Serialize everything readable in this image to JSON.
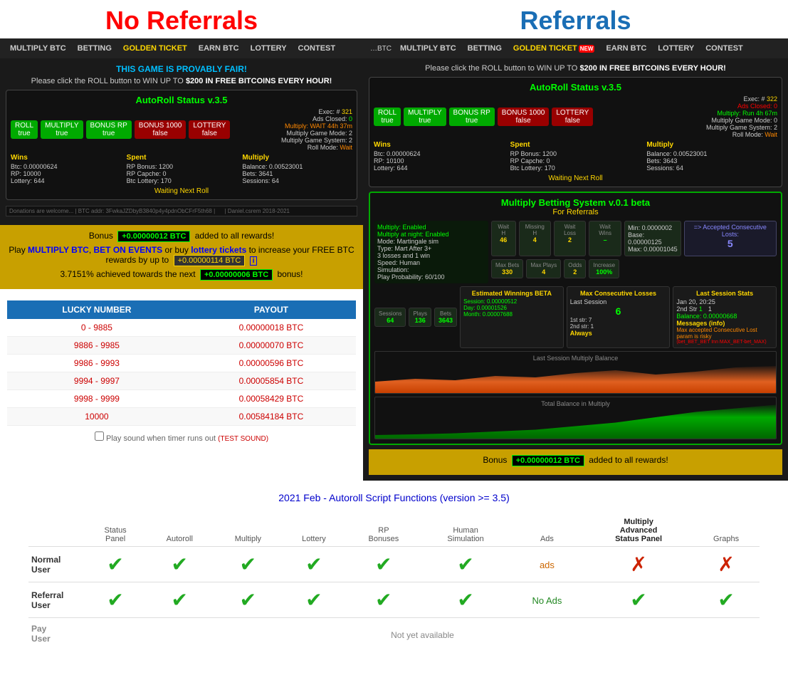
{
  "left": {
    "title": "No Referrals",
    "nav": {
      "items": [
        {
          "label": "MULTIPLY BTC",
          "active": false
        },
        {
          "label": "BETTING",
          "active": false
        },
        {
          "label": "GOLDEN TICKET",
          "active": true,
          "golden": true
        },
        {
          "label": "EARN BTC",
          "active": false
        },
        {
          "label": "LOTTERY",
          "active": false
        },
        {
          "label": "CONTEST",
          "active": false
        }
      ]
    },
    "provably_fair": "THIS GAME IS PROVABLY FAIR!",
    "roll_text": "Please click the ROLL button to WIN UP TO",
    "roll_amount": "$200 IN FREE BITCOINS EVERY HOUR!",
    "autoroll": {
      "title": "AutoRoll Status v.3.5",
      "buttons": [
        "ROLL true",
        "MULTIPLY true",
        "BONUS RP true",
        "BONUS 1000 false",
        "LOTTERY false"
      ],
      "exec_label": "Exec: #",
      "exec_num": "321",
      "ads_closed": "Ads Closed: 0",
      "multiply": "Multiply: WAIT 44h 37m",
      "game_mode": "Multiply Game Mode: 2",
      "game_system": "Multiply Game System: 2",
      "roll_mode": "Roll Mode: Wait",
      "wins_label": "Wins",
      "spent_label": "Spent",
      "multiply_label": "Multiply",
      "btc_stat": "Btc: 0.00000624",
      "rp_bonus": "RP Bonus: 1200",
      "rp_stat": "RP: 10000",
      "btc_lottery": "Btc Lottery: 170",
      "lottery_stat": "Lottery: 644",
      "balance": "Balance: 0.00523001",
      "bets": "Bets: 3641",
      "capache": "RP Capche: 0",
      "sessions": "Sessions: 64",
      "waiting": "Waiting Next Roll"
    },
    "bonus": {
      "bonus_label": "Bonus",
      "bonus_amount": "+0.00000012 BTC",
      "bonus_text": "added to all rewards!",
      "play_text": "Play",
      "multiply_link": "MULTIPLY BTC",
      "bet_link": "BET ON EVENTS",
      "lottery_link": "lottery tickets",
      "free_btc_text": "to increase your FREE BTC rewards by up to",
      "free_amount": "+0.00000114 BTC",
      "progress_text": "3.7151% achieved towards the next",
      "next_bonus": "+0.00000006 BTC",
      "next_bonus_text": "bonus!"
    },
    "payout_table": {
      "col1": "LUCKY NUMBER",
      "col2": "PAYOUT",
      "rows": [
        {
          "range": "0 - 9885",
          "payout": "0.00000018 BTC"
        },
        {
          "range": "9886 - 9985",
          "payout": "0.00000070 BTC"
        },
        {
          "range": "9986 - 9993",
          "payout": "0.00000596 BTC"
        },
        {
          "range": "9994 - 9997",
          "payout": "0.00005854 BTC"
        },
        {
          "range": "9998 - 9999",
          "payout": "0.00058429 BTC"
        },
        {
          "range": "10000",
          "payout": "0.00584184 BTC"
        }
      ]
    },
    "sound_text": "Play sound when timer runs out",
    "sound_test": "(TEST SOUND)"
  },
  "right": {
    "title": "Referrals",
    "nav": {
      "items": [
        {
          "label": "BTC",
          "tiny": true
        },
        {
          "label": "MULTIPLY BTC",
          "active": false
        },
        {
          "label": "BETTING",
          "active": false
        },
        {
          "label": "GOLDEN TICKET",
          "active": true,
          "golden": true,
          "badge": "NEW"
        },
        {
          "label": "EARN BTC",
          "active": false
        },
        {
          "label": "LOTTERY",
          "active": false
        },
        {
          "label": "CONTEST",
          "active": false
        }
      ]
    },
    "roll_text": "Please click the ROLL button to WIN UP TO",
    "roll_amount": "$200 IN FREE BITCOINS EVERY HOUR!",
    "autoroll": {
      "title": "AutoRoll Status v.3.5"
    },
    "multiply_system": {
      "title": "Multiply Betting System v.0.1 beta",
      "subtitle": "For Referrals",
      "enabled": "Multiply: Enabled",
      "at_night": "Multiply at night: Enabled",
      "mode": "Mode: Martingale sim",
      "type": "Type: Mart After 3+",
      "losses_wins": "3 losses and 1 win",
      "speed": "Speed: Human",
      "simulation": "Simulation:",
      "play_prob": "Play Probability: 60/100",
      "wait_h": "Wait H",
      "wait_h_val": "46",
      "missing_h": "Missing H",
      "missing_h_val": "4",
      "wait_loss": "Wait Loss",
      "wait_loss_val": "2",
      "wait_wins": "Wait Wins",
      "wait_wins_val": "",
      "max_bets": "Max Bets",
      "max_bets_val": "330",
      "max_plays": "Max Plays",
      "max_plays_val": "4",
      "odds": "Odds",
      "odds_val": "2",
      "increase": "Increase",
      "increase_val": "100%",
      "min": "Min: 0.0000002",
      "base": "Base: 0.00000125",
      "max_bet": "Max: 0.00001045",
      "accepted": "=> Accepted Consecutive Losts:",
      "accepted_val": "5",
      "sessions": "Sessions",
      "sessions_val": "64",
      "plays": "Plays",
      "plays_val": "136",
      "bets": "Bets",
      "bets_val": "3643",
      "est_title": "Estimated Winnings BETA",
      "session_est": "Session: 0.00000512",
      "day_est": "Day: 0.00001526",
      "month_est": "Month: 0.00007688",
      "max_cons_title": "Max Consecutive Losses",
      "max_cons_sub": "Last Session",
      "always": "Always",
      "first_str": "1st str: 7",
      "second_str": "2nd str: 1",
      "last_session_title": "Last Session Stats",
      "last_session_date": "Jan 20, 20:25",
      "first_str_last": "2nd Str",
      "first_str_val": "1",
      "second_str_val": "1",
      "balance_val": "0.00000668",
      "messages_title": "Messages (info)",
      "max_accepted_text": "Max accepted Consecutive Lost param is risky",
      "warning": "(bet_BET_BET Inn MAX_BET-bet_MAX)",
      "last_session_graph": "Last Session Multiply Balance",
      "total_balance_graph": "Total Balance in Multiply"
    },
    "bonus": {
      "bonus_label": "Bonus",
      "bonus_amount": "+0.00000012 BTC",
      "bonus_text": "added to all rewards!"
    }
  },
  "comparison": {
    "title": "2021 Feb - Autoroll Script Functions (version >= 3.5)",
    "columns": [
      {
        "label": "Status\nPanel",
        "bold": false
      },
      {
        "label": "Autoroll",
        "bold": false
      },
      {
        "label": "Multiply",
        "bold": false
      },
      {
        "label": "Lottery",
        "bold": false
      },
      {
        "label": "RP\nBonuses",
        "bold": false
      },
      {
        "label": "Human\nSimulation",
        "bold": false
      },
      {
        "label": "Ads",
        "bold": false
      },
      {
        "label": "Multiply\nAdvanced\nStatus Panel",
        "bold": true
      },
      {
        "label": "Graphs",
        "bold": false
      }
    ],
    "rows": [
      {
        "user_type": "Normal\nUser",
        "values": [
          "check",
          "check",
          "check",
          "check",
          "check",
          "check",
          "ads",
          "cross",
          "cross"
        ]
      },
      {
        "user_type": "Referral\nUser",
        "values": [
          "check",
          "check",
          "check",
          "check",
          "check",
          "check",
          "noads",
          "check",
          "check"
        ]
      },
      {
        "user_type": "Pay\nUser",
        "values": [
          "na",
          "na",
          "na",
          "na",
          "na",
          "na",
          "na",
          "na",
          "na"
        ]
      }
    ],
    "not_available": "Not yet available"
  }
}
